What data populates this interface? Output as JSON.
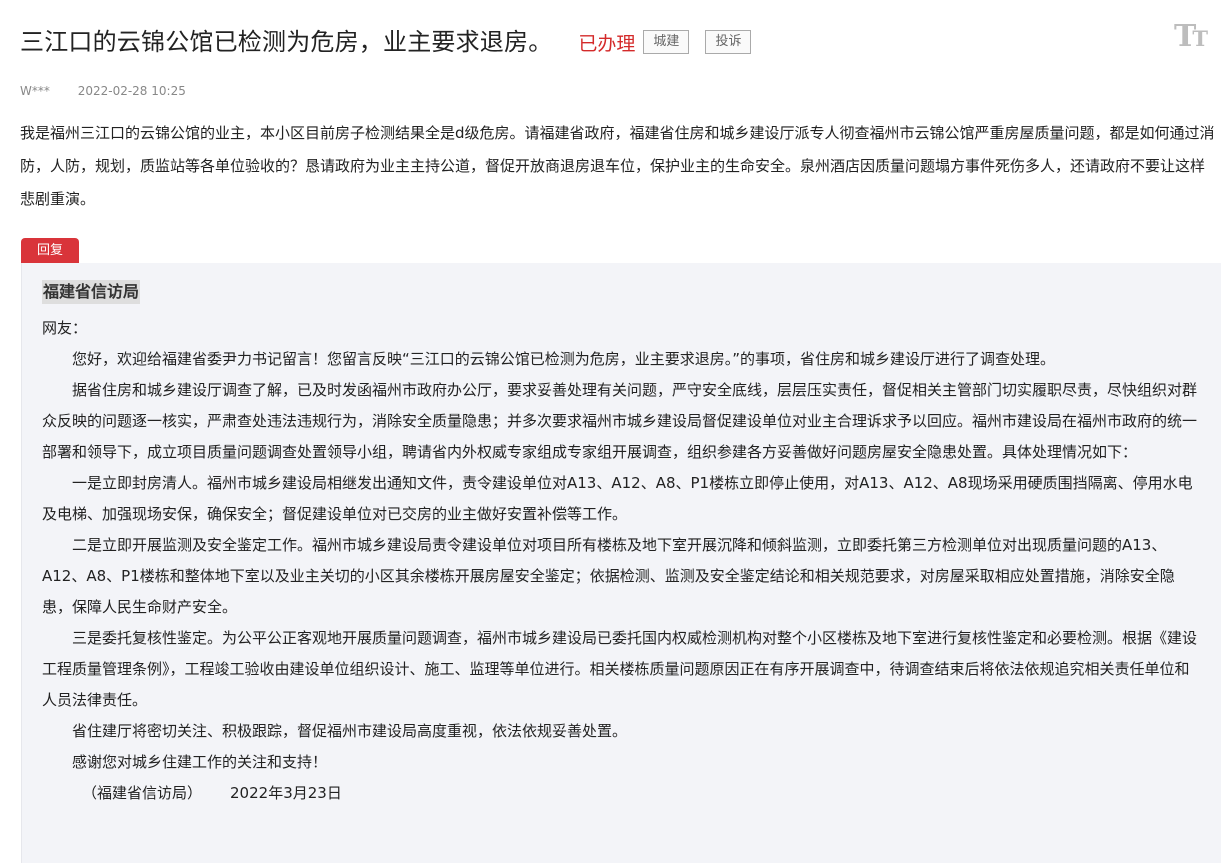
{
  "header": {
    "title": "三江口的云锦公馆已检测为危房，业主要求退房。",
    "status": "已办理",
    "tags": [
      "城建",
      "投诉"
    ]
  },
  "font_toggle": {
    "icon": "font-size-icon",
    "large": "T",
    "small": "T"
  },
  "meta": {
    "user": "W***",
    "date": "2022-02-28 10:25"
  },
  "question": "我是福州三江口的云锦公馆的业主，本小区目前房子检测结果全是d级危房。请福建省政府，福建省住房和城乡建设厅派专人彻查福州市云锦公馆严重房屋质量问题，都是如何通过消防，人防，规划，质监站等各单位验收的？恳请政府为业主主持公道，督促开放商退房退车位，保护业主的生命安全。泉州酒店因质量问题塌方事件死伤多人，还请政府不要让这样悲剧重演。",
  "reply": {
    "tab_label": "回复",
    "org": "福建省信访局",
    "salutation": "网友：",
    "paragraphs": [
      "您好，欢迎给福建省委尹力书记留言！您留言反映“三江口的云锦公馆已检测为危房，业主要求退房。”的事项，省住房和城乡建设厅进行了调查处理。",
      "据省住房和城乡建设厅调查了解，已及时发函福州市政府办公厅，要求妥善处理有关问题，严守安全底线，层层压实责任，督促相关主管部门切实履职尽责，尽快组织对群众反映的问题逐一核实，严肃查处违法违规行为，消除安全质量隐患；并多次要求福州市城乡建设局督促建设单位对业主合理诉求予以回应。福州市建设局在福州市政府的统一部署和领导下，成立项目质量问题调查处置领导小组，聘请省内外权威专家组成专家组开展调查，组织参建各方妥善做好问题房屋安全隐患处置。具体处理情况如下：",
      "一是立即封房清人。福州市城乡建设局相继发出通知文件，责令建设单位对A13、A12、A8、P1楼栋立即停止使用，对A13、A12、A8现场采用硬质围挡隔离、停用水电及电梯、加强现场安保，确保安全；督促建设单位对已交房的业主做好安置补偿等工作。",
      "二是立即开展监测及安全鉴定工作。福州市城乡建设局责令建设单位对项目所有楼栋及地下室开展沉降和倾斜监测，立即委托第三方检测单位对出现质量问题的A13、A12、A8、P1楼栋和整体地下室以及业主关切的小区其余楼栋开展房屋安全鉴定；依据检测、监测及安全鉴定结论和相关规范要求，对房屋采取相应处置措施，消除安全隐患，保障人民生命财产安全。",
      "三是委托复核性鉴定。为公平公正客观地开展质量问题调查，福州市城乡建设局已委托国内权威检测机构对整个小区楼栋及地下室进行复核性鉴定和必要检测。根据《建设工程质量管理条例》，工程竣工验收由建设单位组织设计、施工、监理等单位进行。相关楼栋质量问题原因正在有序开展调查中，待调查结束后将依法依规追究相关责任单位和人员法律责任。",
      "省住建厅将密切关注、积极跟踪，督促福州市建设局高度重视，依法依规妥善处置。",
      "感谢您对城乡住建工作的关注和支持！"
    ],
    "sign_org": "（福建省信访局）",
    "sign_date": "2022年3月23日"
  }
}
